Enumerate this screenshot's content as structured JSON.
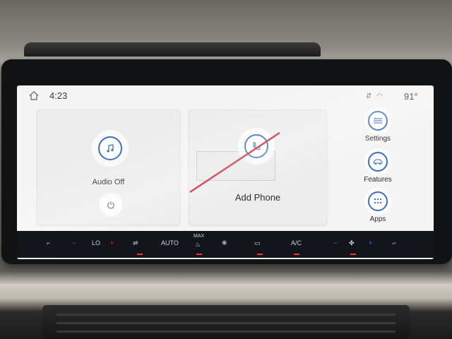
{
  "status": {
    "time": "4:23",
    "temperature": "91°",
    "status_icons": "⇵ ◠"
  },
  "cards": {
    "audio": {
      "label": "Audio Off"
    },
    "phone": {
      "label": "Add Phone"
    }
  },
  "sidebar": {
    "items": [
      {
        "label": "Settings",
        "icon": "settings-sliders-icon"
      },
      {
        "label": "Features",
        "icon": "car-icon"
      },
      {
        "label": "Apps",
        "icon": "grid-icon"
      }
    ]
  },
  "climate": {
    "lo": "LO",
    "auto": "AUTO",
    "max": "MAX",
    "ac": "A/C",
    "minus": "−",
    "plus": "+"
  },
  "colors": {
    "accent": "#3b6fc4",
    "screen_bg": "#f4f4f4",
    "climate_bar": "#14151a",
    "indicator_red": "#e23b3b"
  }
}
